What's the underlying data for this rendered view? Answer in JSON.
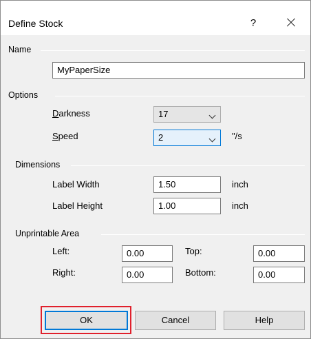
{
  "window": {
    "title": "Define Stock",
    "help_glyph": "?"
  },
  "name_section": {
    "label": "Name",
    "value": "MyPaperSize"
  },
  "options": {
    "label": "Options",
    "darkness_label": {
      "accel": "D",
      "rest": "arkness"
    },
    "darkness_value": "17",
    "speed_label": {
      "accel": "S",
      "rest": "peed"
    },
    "speed_value": "2",
    "speed_unit": "\"/s"
  },
  "dimensions": {
    "label": "Dimensions",
    "width_label": "Label Width",
    "width_value": "1.50",
    "height_label": "Label Height",
    "height_value": "1.00",
    "unit": "inch"
  },
  "unprintable": {
    "label": "Unprintable Area",
    "left_label": "Left:",
    "left_value": "0.00",
    "top_label": "Top:",
    "top_value": "0.00",
    "right_label": "Right:",
    "right_value": "0.00",
    "bottom_label": "Bottom:",
    "bottom_value": "0.00"
  },
  "buttons": {
    "ok": "OK",
    "cancel": "Cancel",
    "help": "Help"
  },
  "colors": {
    "focus_blue": "#0078d7",
    "highlight_red": "#e0202c",
    "dialog_bg": "#f0f0f0"
  }
}
